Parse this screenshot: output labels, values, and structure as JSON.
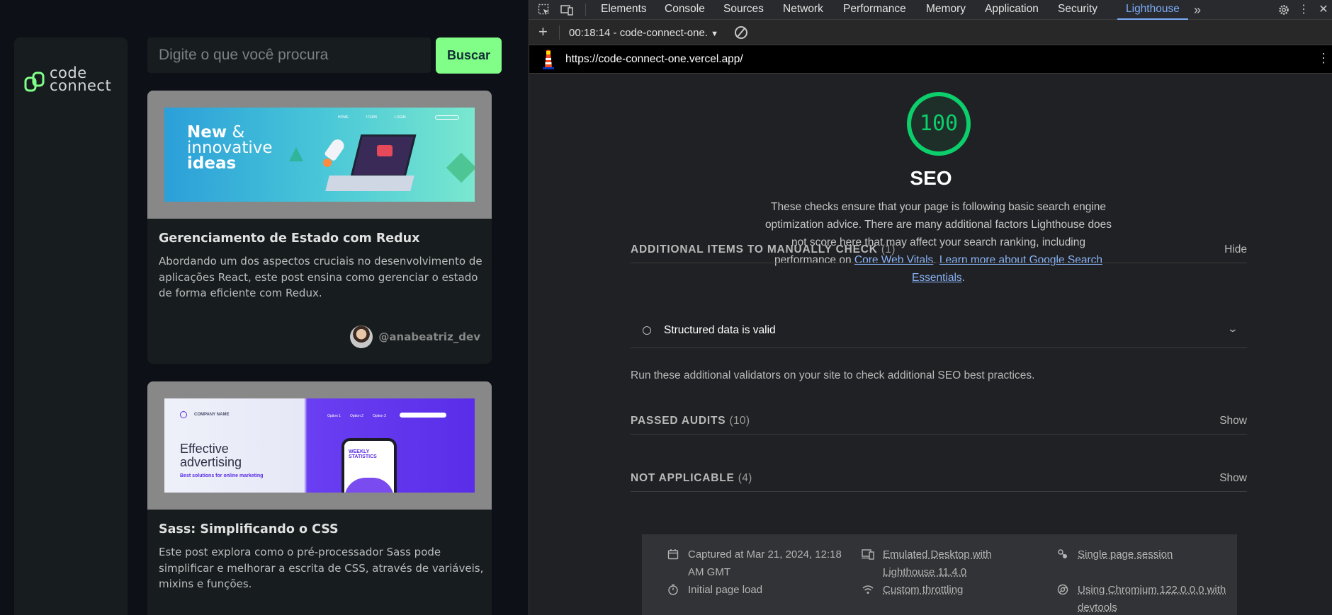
{
  "site": {
    "logo_text_line1": "code",
    "logo_text_line2": "connect",
    "search_placeholder": "Digite o que você procura",
    "search_button": "Buscar",
    "cards": [
      {
        "banner_title_line1": "New",
        "banner_title_amp": "&",
        "banner_title_line2": "innovative",
        "banner_title_line3": "ideas",
        "title": "Gerenciamento de Estado com Redux",
        "description": "Abordando um dos aspectos cruciais no desenvolvimento de aplicações React, este post ensina como gerenciar o estado de forma eficiente com Redux.",
        "author": "@anabeatriz_dev"
      },
      {
        "banner_company": "COMPANY NAME",
        "banner_title_line1": "Effective",
        "banner_title_line2": "advertising",
        "banner_subtitle": "Best solutions for online marketing",
        "banner_phone_text": "WEEKLY STATISTICS",
        "title": "Sass: Simplificando o CSS",
        "description": "Este post explora como o pré-processador Sass pode simplificar e melhorar a escrita de CSS, através de variáveis, mixins e funções."
      }
    ]
  },
  "devtools": {
    "tabs": [
      "Elements",
      "Console",
      "Sources",
      "Network",
      "Performance",
      "Memory",
      "Application",
      "Security",
      "Lighthouse"
    ],
    "active_tab": "Lighthouse",
    "report_select": "00:18:14 - code-connect-one.",
    "url": "https://code-connect-one.vercel.app/",
    "category": {
      "score": "100",
      "title": "SEO",
      "description": "These checks ensure that your page is following basic search engine optimization advice. There are many additional factors Lighthouse does not score here that may affect your search ranking, including performance on",
      "link1": "Core Web Vitals",
      "link_sep": ".",
      "link2": "Learn more about Google Search Essentials",
      "link_end": "."
    },
    "manual": {
      "title": "ADDITIONAL ITEMS TO MANUALLY CHECK",
      "count": "(1)",
      "action": "Hide",
      "audit": "Structured data is valid",
      "note": "Run these additional validators on your site to check additional SEO best practices."
    },
    "passed": {
      "title": "PASSED AUDITS",
      "count": "(10)",
      "action": "Show"
    },
    "na": {
      "title": "NOT APPLICABLE",
      "count": "(4)",
      "action": "Show"
    },
    "footer": {
      "captured": "Captured at Mar 21, 2024, 12:18 AM GMT",
      "load": "Initial page load",
      "emulated": "Emulated Desktop with Lighthouse 11.4.0",
      "throttling": "Custom throttling",
      "session": "Single page session",
      "chromium": "Using Chromium 122.0.0.0 with devtools"
    }
  }
}
